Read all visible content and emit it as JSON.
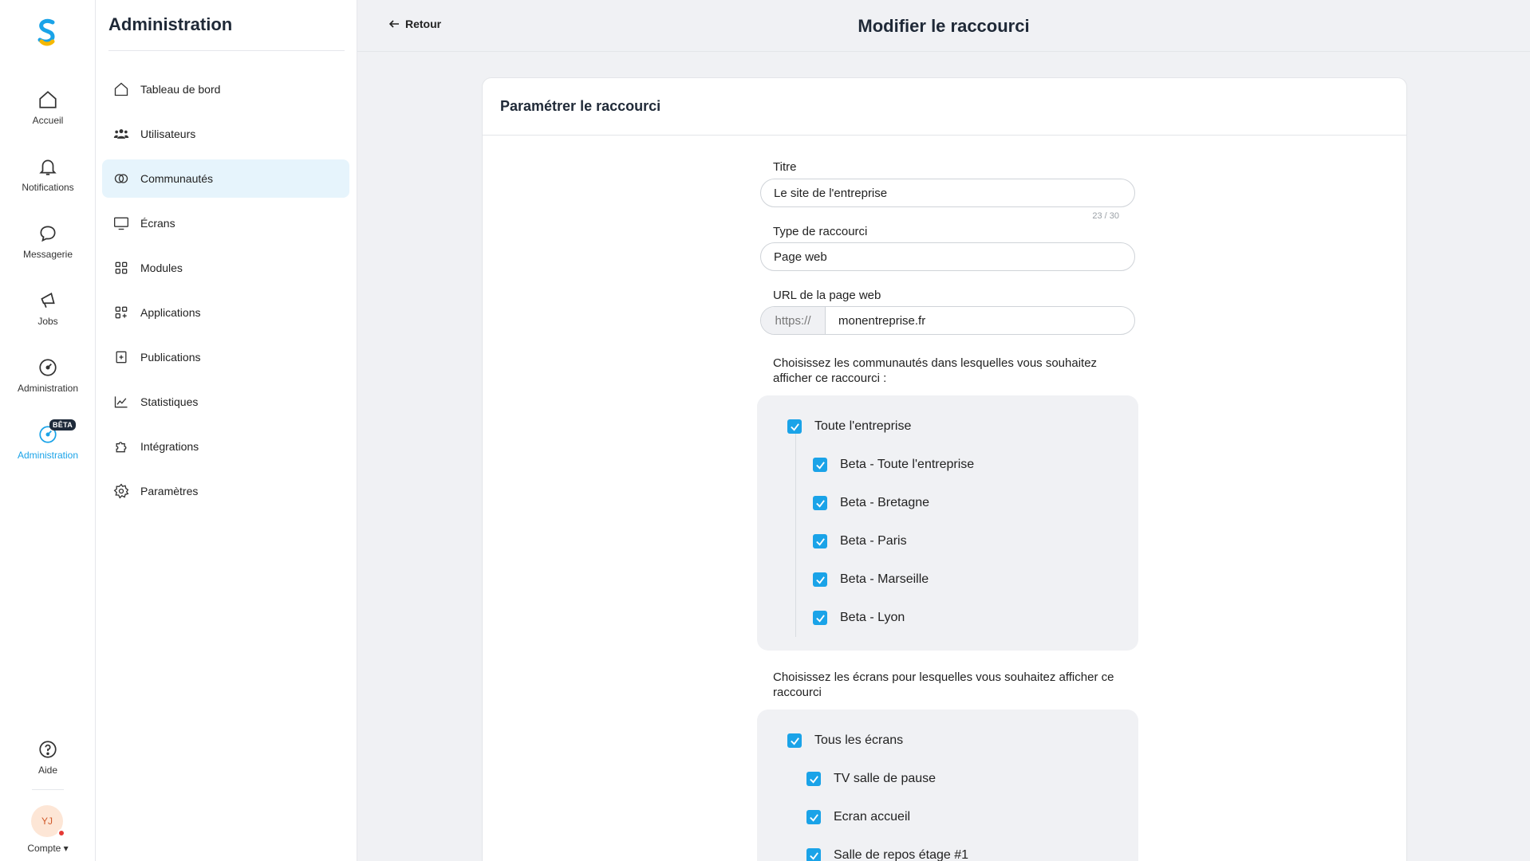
{
  "rail": {
    "items": [
      {
        "label": "Accueil"
      },
      {
        "label": "Notifications"
      },
      {
        "label": "Messagerie"
      },
      {
        "label": "Jobs"
      },
      {
        "label": "Administration"
      },
      {
        "label": "Administration",
        "badge": "BÊTA"
      }
    ],
    "help": "Aide",
    "avatar_initials": "YJ",
    "account": "Compte ▾",
    "accent_color": "#1aa3e8"
  },
  "sidebar": {
    "title": "Administration",
    "items": [
      {
        "label": "Tableau de bord",
        "icon": "home-icon"
      },
      {
        "label": "Utilisateurs",
        "icon": "users-icon"
      },
      {
        "label": "Communautés",
        "icon": "communities-icon",
        "active": true
      },
      {
        "label": "Écrans",
        "icon": "screen-icon"
      },
      {
        "label": "Modules",
        "icon": "modules-icon"
      },
      {
        "label": "Applications",
        "icon": "applications-icon"
      },
      {
        "label": "Publications",
        "icon": "publications-icon"
      },
      {
        "label": "Statistiques",
        "icon": "statistics-icon"
      },
      {
        "label": "Intégrations",
        "icon": "puzzle-icon"
      },
      {
        "label": "Paramètres",
        "icon": "gear-icon"
      }
    ]
  },
  "header": {
    "back": "Retour",
    "title": "Modifier le raccourci"
  },
  "card": {
    "title": "Paramétrer le raccourci",
    "fields": {
      "title_label": "Titre",
      "title_value": "Le site de l'entreprise",
      "title_counter": "23 / 30",
      "type_label": "Type de raccourci",
      "type_value": "Page web",
      "url_label": "URL de la page web",
      "url_prefix": "https://",
      "url_value": "monentreprise.fr"
    },
    "communities": {
      "question": "Choisissez les communautés dans lesquelles vous souhaitez afficher ce raccourci :",
      "parent": "Toute l'entreprise",
      "children": [
        "Beta - Toute l'entreprise",
        "Beta - Bretagne",
        "Beta - Paris",
        "Beta - Marseille",
        "Beta - Lyon"
      ]
    },
    "screens": {
      "question": "Choisissez les écrans pour lesquelles vous souhaitez afficher ce raccourci",
      "parent": "Tous les écrans",
      "children": [
        "TV salle de pause",
        "Ecran accueil",
        "Salle de repos étage #1"
      ]
    }
  }
}
